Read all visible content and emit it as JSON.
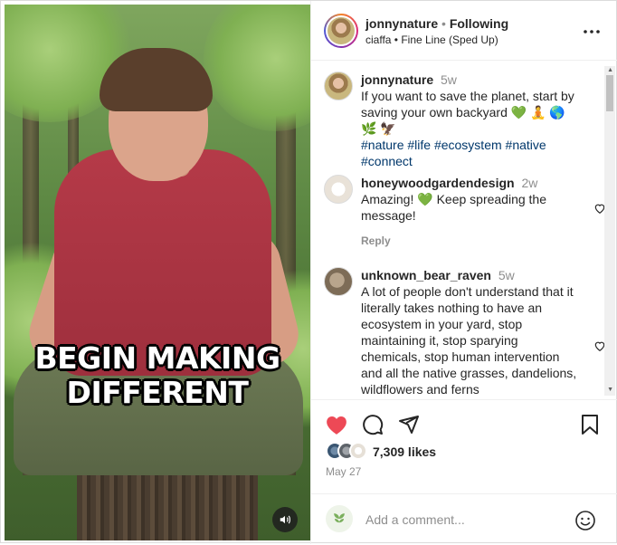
{
  "post": {
    "caption_overlay_line1": "BEGIN MAKING",
    "caption_overlay_line2": "DIFFERENT"
  },
  "header": {
    "username": "jonnynature",
    "separator": "•",
    "follow_status": "Following",
    "audio": "ciaffa • Fine Line (Sped Up)"
  },
  "caption": {
    "username": "jonnynature",
    "time": "5w",
    "text": "If you want to save the planet, start by saving your own backyard 💚 🧘 🌎 🌿 🦅",
    "hashtags": "#nature #life #ecosystem #native #connect"
  },
  "comments": [
    {
      "username": "honeywoodgardendesign",
      "time": "2w",
      "text": "Amazing! 💚  Keep spreading the message!",
      "reply_label": "Reply"
    },
    {
      "username": "unknown_bear_raven",
      "time": "5w",
      "text": "A lot of people don't understand that it literally takes nothing to have an ecosystem in your yard, stop maintaining it, stop sparying chemicals, stop human intervention and all the native grasses, dandelions, wildflowers and ferns"
    }
  ],
  "stats": {
    "likes": "7,309 likes",
    "date": "May 27"
  },
  "composer": {
    "placeholder": "Add a comment..."
  },
  "icons": {
    "like": "heart-icon",
    "comment": "comment-icon",
    "share": "paper-plane-icon",
    "save": "bookmark-icon",
    "more": "more-icon",
    "sound": "speaker-icon",
    "emoji": "emoji-icon"
  },
  "colors": {
    "like_red": "#ed4956",
    "link_blue": "#00376b",
    "text": "#262626",
    "muted": "#8e8e8e"
  }
}
